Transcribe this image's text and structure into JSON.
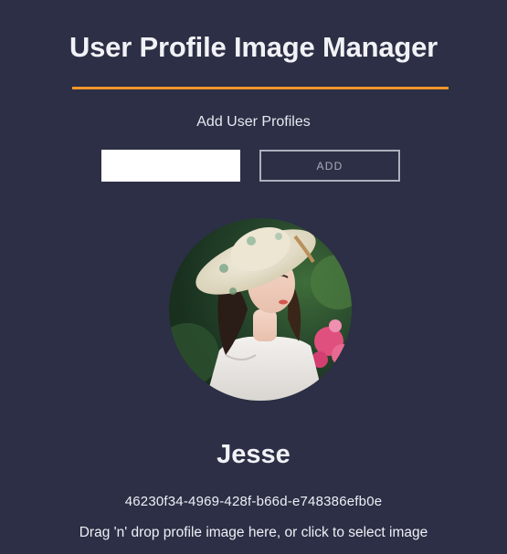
{
  "header": {
    "title": "User Profile Image Manager"
  },
  "add_form": {
    "label": "Add User Profiles",
    "input_value": "",
    "button_label": "ADD"
  },
  "profile": {
    "name": "Jesse",
    "id": "46230f34-4969-428f-b66d-e748386efb0e",
    "dropzone_text": "Drag 'n' drop profile image here, or click to select image"
  },
  "colors": {
    "background": "#2c2f45",
    "accent_rule": "#f0952a",
    "text": "#eef0f6"
  }
}
